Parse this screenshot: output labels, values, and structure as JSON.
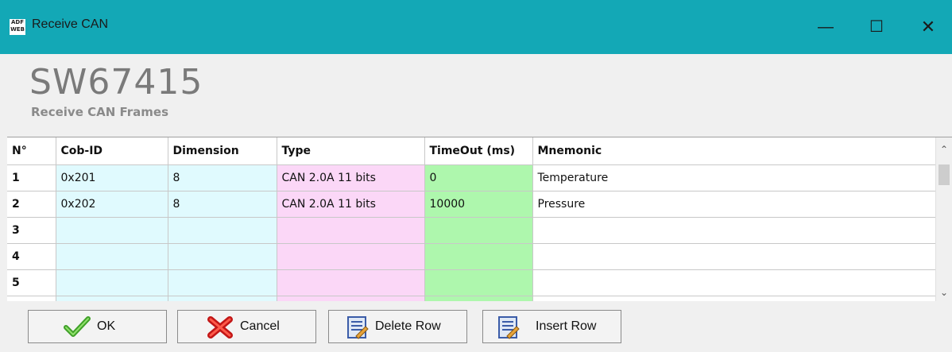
{
  "window": {
    "title": "Receive CAN",
    "icon_text": "ADF WEB",
    "minimize_glyph": "—",
    "maximize_glyph": "☐",
    "close_glyph": "✕"
  },
  "header": {
    "title": "SW67415",
    "subtitle": "Receive CAN Frames"
  },
  "table": {
    "columns": [
      "N°",
      "Cob-ID",
      "Dimension",
      "Type",
      "TimeOut (ms)",
      "Mnemonic"
    ],
    "rows": [
      {
        "n": "1",
        "cob_id": "0x201",
        "dimension": "8",
        "type": "CAN 2.0A 11 bits",
        "timeout": "0",
        "mnemonic": "Temperature"
      },
      {
        "n": "2",
        "cob_id": "0x202",
        "dimension": "8",
        "type": "CAN 2.0A 11 bits",
        "timeout": "10000",
        "mnemonic": "Pressure"
      },
      {
        "n": "3",
        "cob_id": "",
        "dimension": "",
        "type": "",
        "timeout": "",
        "mnemonic": ""
      },
      {
        "n": "4",
        "cob_id": "",
        "dimension": "",
        "type": "",
        "timeout": "",
        "mnemonic": ""
      },
      {
        "n": "5",
        "cob_id": "",
        "dimension": "",
        "type": "",
        "timeout": "",
        "mnemonic": ""
      }
    ]
  },
  "buttons": {
    "ok": "OK",
    "cancel": "Cancel",
    "delete_row": "Delete Row",
    "insert_row": "Insert Row"
  },
  "colors": {
    "titlebar": "#13a8b6",
    "cob_id_col": "#e0fafe",
    "type_col": "#fbd7f7",
    "timeout_col": "#aef7ad"
  }
}
